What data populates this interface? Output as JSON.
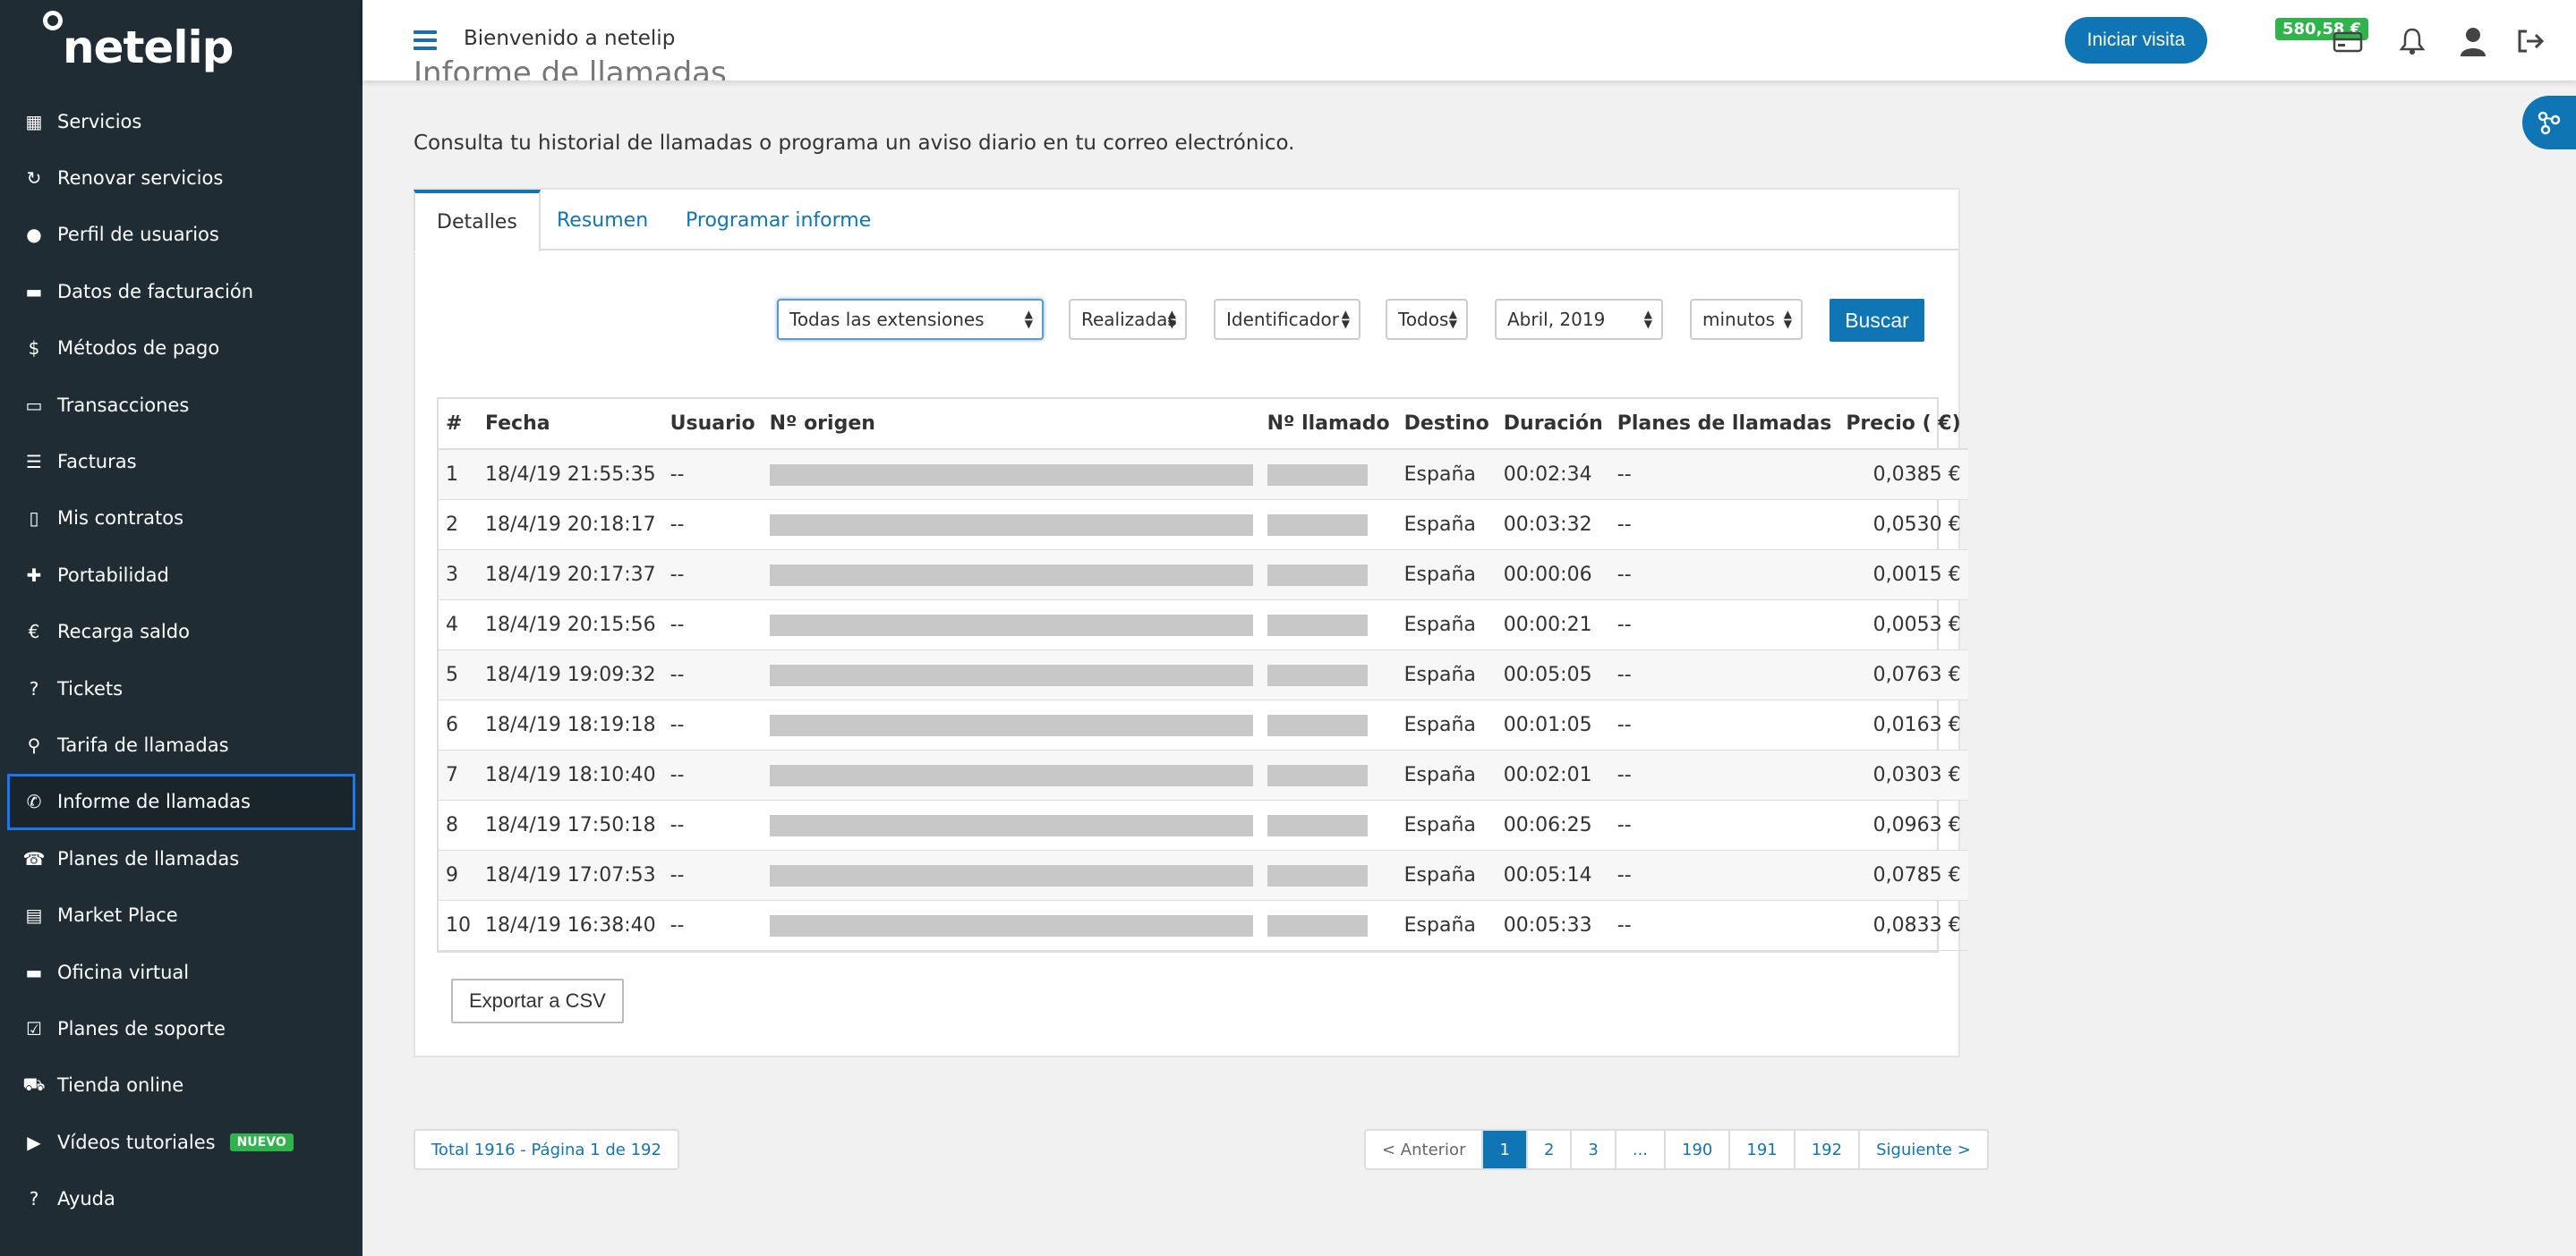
{
  "brand": {
    "logo_text": "netelip"
  },
  "sidebar": {
    "items": [
      {
        "label": "Servicios",
        "icon": "grid-icon",
        "glyph": "▦"
      },
      {
        "label": "Renovar servicios",
        "icon": "refresh-icon",
        "glyph": "↻"
      },
      {
        "label": "Perfil de usuarios",
        "icon": "user-icon",
        "glyph": "●"
      },
      {
        "label": "Datos de facturación",
        "icon": "briefcase-icon",
        "glyph": "▬"
      },
      {
        "label": "Métodos de pago",
        "icon": "dollar-icon",
        "glyph": "$"
      },
      {
        "label": "Transacciones",
        "icon": "card-icon",
        "glyph": "▭"
      },
      {
        "label": "Facturas",
        "icon": "list-icon",
        "glyph": "☰"
      },
      {
        "label": "Mis contratos",
        "icon": "file-icon",
        "glyph": "▯"
      },
      {
        "label": "Portabilidad",
        "icon": "plus-icon",
        "glyph": "✚"
      },
      {
        "label": "Recarga saldo",
        "icon": "euro-icon",
        "glyph": "€"
      },
      {
        "label": "Tickets",
        "icon": "question-icon",
        "glyph": "?"
      },
      {
        "label": "Tarifa de llamadas",
        "icon": "search-icon",
        "glyph": "⚲"
      },
      {
        "label": "Informe de llamadas",
        "icon": "phone-icon",
        "glyph": "✆"
      },
      {
        "label": "Planes de llamadas",
        "icon": "telephone-icon",
        "glyph": "☎"
      },
      {
        "label": "Market Place",
        "icon": "store-icon",
        "glyph": "▤"
      },
      {
        "label": "Oficina virtual",
        "icon": "briefcase-icon",
        "glyph": "▬"
      },
      {
        "label": "Planes de soporte",
        "icon": "check-square-icon",
        "glyph": "☑"
      },
      {
        "label": "Tienda online",
        "icon": "cart-icon",
        "glyph": "⛟"
      },
      {
        "label": "Vídeos tutoriales",
        "icon": "video-icon",
        "glyph": "▶",
        "badge": "NUEVO"
      },
      {
        "label": "Ayuda",
        "icon": "question-icon",
        "glyph": "?"
      }
    ],
    "active_index": 12
  },
  "topbar": {
    "welcome": "Bienvenido a netelip",
    "visit_button": "Iniciar visita",
    "balance": "580,58 €"
  },
  "page": {
    "title": "Informe de llamadas",
    "intro": "Consulta tu historial de llamadas o programa un aviso diario en tu correo electrónico."
  },
  "tabs": [
    "Detalles",
    "Resumen",
    "Programar informe"
  ],
  "filters": {
    "extensions": "Todas las extensiones",
    "direction": "Realizadas",
    "identifier": "Identificador",
    "status": "Todos",
    "month": "Abril, 2019",
    "unit": "minutos",
    "search_button": "Buscar"
  },
  "table": {
    "headers": [
      "#",
      "Fecha",
      "Usuario",
      "Nº origen",
      "Nº llamado",
      "Destino",
      "Duración",
      "Planes de llamadas",
      "Precio ( €)"
    ],
    "rows": [
      [
        "1",
        "18/4/19 21:55:35",
        "--",
        "España",
        "00:02:34",
        "--",
        "0,0385 €"
      ],
      [
        "2",
        "18/4/19 20:18:17",
        "--",
        "España",
        "00:03:32",
        "--",
        "0,0530 €"
      ],
      [
        "3",
        "18/4/19 20:17:37",
        "--",
        "España",
        "00:00:06",
        "--",
        "0,0015 €"
      ],
      [
        "4",
        "18/4/19 20:15:56",
        "--",
        "España",
        "00:00:21",
        "--",
        "0,0053 €"
      ],
      [
        "5",
        "18/4/19 19:09:32",
        "--",
        "España",
        "00:05:05",
        "--",
        "0,0763 €"
      ],
      [
        "6",
        "18/4/19 18:19:18",
        "--",
        "España",
        "00:01:05",
        "--",
        "0,0163 €"
      ],
      [
        "7",
        "18/4/19 18:10:40",
        "--",
        "España",
        "00:02:01",
        "--",
        "0,0303 €"
      ],
      [
        "8",
        "18/4/19 17:50:18",
        "--",
        "España",
        "00:06:25",
        "--",
        "0,0963 €"
      ],
      [
        "9",
        "18/4/19 17:07:53",
        "--",
        "España",
        "00:05:14",
        "--",
        "0,0785 €"
      ],
      [
        "10",
        "18/4/19 16:38:40",
        "--",
        "España",
        "00:05:33",
        "--",
        "0,0833 €"
      ]
    ]
  },
  "export_button": "Exportar a CSV",
  "footer": {
    "total": "Total 1916 - Página 1 de 192",
    "pages": [
      "< Anterior",
      "1",
      "2",
      "3",
      "...",
      "190",
      "191",
      "192",
      "Siguiente >"
    ],
    "current_page": "1"
  },
  "colors": {
    "sidebar": "#1f2c33",
    "accent": "#0f75b5",
    "balance": "#2fb34b"
  }
}
